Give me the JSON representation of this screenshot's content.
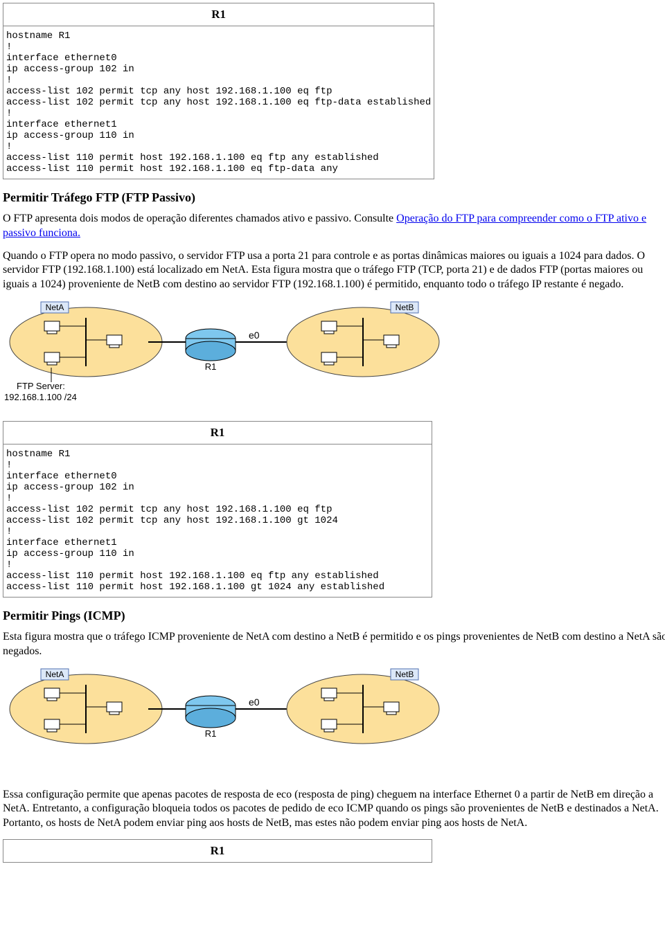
{
  "box1": {
    "title": "R1",
    "config": "hostname R1\n!\ninterface ethernet0\nip access-group 102 in\n!\naccess-list 102 permit tcp any host 192.168.1.100 eq ftp\naccess-list 102 permit tcp any host 192.168.1.100 eq ftp-data established\n!\ninterface ethernet1\nip access-group 110 in\n!\naccess-list 110 permit host 192.168.1.100 eq ftp any established\naccess-list 110 permit host 192.168.1.100 eq ftp-data any"
  },
  "section_ftp_passive": {
    "heading": "Permitir Tráfego FTP (FTP Passivo)",
    "p1_a": "O FTP apresenta dois modos de operação diferentes chamados ativo e passivo. Consulte ",
    "p1_link": "Operação do FTP para compreender como o FTP ativo e passivo funciona.",
    "p2": "Quando o FTP opera no modo passivo, o servidor FTP usa a porta 21 para controle e as portas dinâmicas maiores ou iguais a 1024 para dados. O servidor FTP (192.168.1.100) está localizado em NetA. Esta figura mostra que o tráfego FTP (TCP, porta 21) e de dados FTP (portas maiores ou iguais a 1024) proveniente de NetB com destino ao servidor FTP (192.168.1.100) é permitido, enquanto todo o tráfego IP restante é negado."
  },
  "diagram1": {
    "net_a": "NetA",
    "net_b": "NetB",
    "router": "R1",
    "iface": "e0",
    "server_label1": "FTP Server:",
    "server_label2": "192.168.1.100 /24"
  },
  "box2": {
    "title": "R1",
    "config": "hostname R1\n!\ninterface ethernet0\nip access-group 102 in\n!\naccess-list 102 permit tcp any host 192.168.1.100 eq ftp\naccess-list 102 permit tcp any host 192.168.1.100 gt 1024\n!\ninterface ethernet1\nip access-group 110 in\n!\naccess-list 110 permit host 192.168.1.100 eq ftp any established\naccess-list 110 permit host 192.168.1.100 gt 1024 any established"
  },
  "section_icmp": {
    "heading": "Permitir Pings (ICMP)",
    "p1": "Esta figura mostra que o tráfego ICMP proveniente de NetA com destino a NetB é permitido e os pings provenientes de NetB com destino a NetA são negados."
  },
  "diagram2": {
    "net_a": "NetA",
    "net_b": "NetB",
    "router": "R1",
    "iface": "e0"
  },
  "p_after_diagram2": "Essa configuração permite que apenas pacotes de resposta de eco (resposta de ping) cheguem na interface Ethernet 0 a partir de NetB em direção a NetA. Entretanto, a configuração bloqueia todos os pacotes de pedido de eco ICMP quando os pings são provenientes de NetB e destinados a NetA. Portanto, os hosts de NetA podem enviar ping aos hosts de NetB, mas estes não podem enviar ping aos hosts de NetA.",
  "box3": {
    "title": "R1"
  }
}
